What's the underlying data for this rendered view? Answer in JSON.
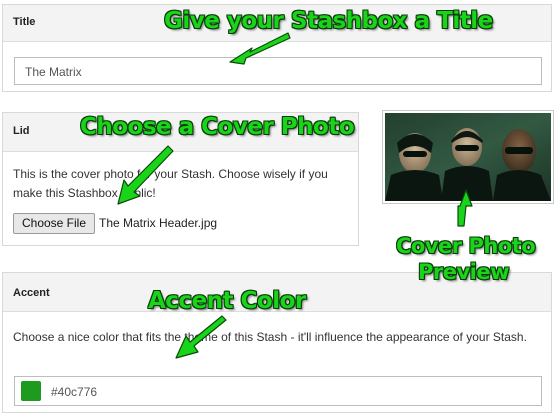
{
  "title_section": {
    "label": "Title",
    "input_value": "The Matrix"
  },
  "lid_section": {
    "label": "Lid",
    "description": "This is the cover photo for your Stash. Choose wisely if you make this Stashbox public!",
    "choose_file_label": "Choose File",
    "file_name": "The Matrix Header.jpg"
  },
  "cover_preview": {
    "image_description": "movie-still"
  },
  "accent_section": {
    "label": "Accent",
    "description": "Choose a nice color that fits the theme of this Stash - it'll influence the appearance of your Stash.",
    "color_value": "#40c776",
    "swatch_color": "#1e9a1e"
  },
  "annotations": {
    "title_note": "Give your Stashbox a Title",
    "cover_note": "Choose a Cover Photo",
    "preview_note_line1": "Cover Photo",
    "preview_note_line2": "Preview",
    "accent_note": "Accent Color",
    "color": "#19d419"
  },
  "icons": {
    "arrow": "green-arrow-icon"
  }
}
